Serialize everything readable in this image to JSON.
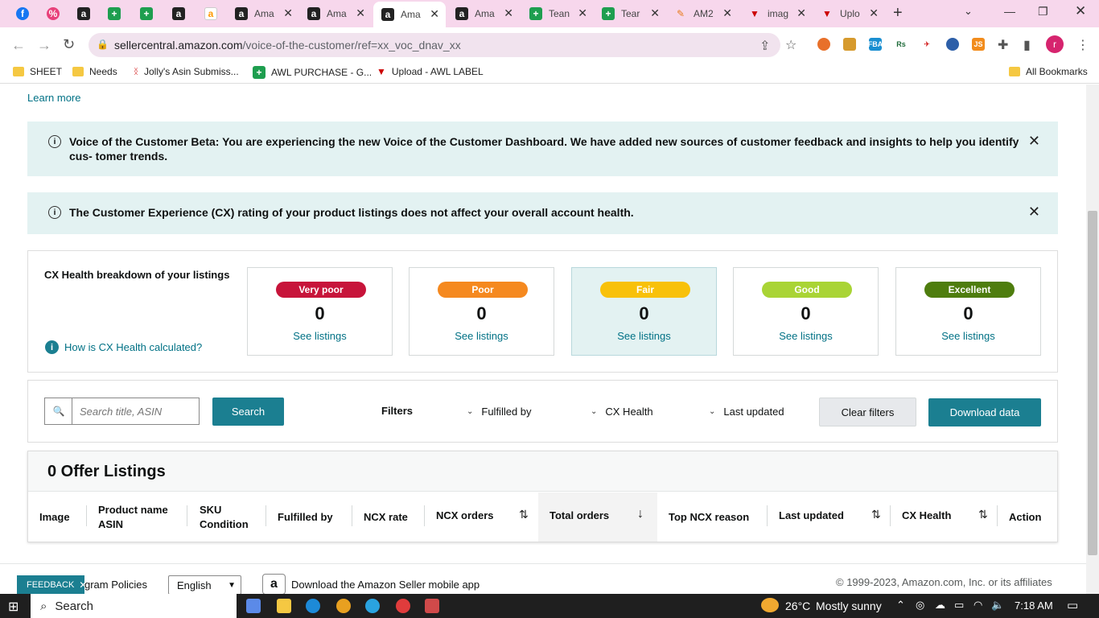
{
  "browser": {
    "tabs": [
      {
        "title": "",
        "icon": "facebook-icon"
      },
      {
        "title": "",
        "icon": "percent-icon"
      },
      {
        "title": "",
        "icon": "amazon-a-icon"
      },
      {
        "title": "",
        "icon": "sheets-icon"
      },
      {
        "title": "",
        "icon": "sheets-icon"
      },
      {
        "title": "",
        "icon": "amazon-a-icon"
      },
      {
        "title": "",
        "icon": "amazon-smile-icon"
      },
      {
        "title": "Ama",
        "icon": "amazon-a-icon"
      },
      {
        "title": "Ama",
        "icon": "amazon-a-icon"
      },
      {
        "title": "Ama",
        "icon": "amazon-a-icon",
        "active": true
      },
      {
        "title": "Ama",
        "icon": "amazon-a-icon"
      },
      {
        "title": "Tean",
        "icon": "sheets-icon"
      },
      {
        "title": "Tear",
        "icon": "sheets-icon"
      },
      {
        "title": "AM2",
        "icon": "pen-icon"
      },
      {
        "title": "imag",
        "icon": "v-logo-icon"
      },
      {
        "title": "Uplo",
        "icon": "v-logo-icon"
      }
    ],
    "new_tab": "+",
    "url_domain": "sellercentral.amazon.com",
    "url_path": "/voice-of-the-customer/ref=xx_voc_dnav_xx",
    "profile_initial": "r",
    "bookmarks": [
      {
        "label": "SHEET",
        "icon": "folder-icon"
      },
      {
        "label": "Needs",
        "icon": "folder-icon"
      },
      {
        "label": "Jolly's Asin Submiss...",
        "icon": "bookmark-icon"
      },
      {
        "label": "AWL PURCHASE - G...",
        "icon": "sheets-icon"
      },
      {
        "label": "Upload - AWL LABEL",
        "icon": "v-logo-icon"
      }
    ],
    "all_bookmarks": "All Bookmarks"
  },
  "page": {
    "learn_more": "Learn more",
    "alert1": "Voice of the Customer Beta: You are experiencing the new Voice of the Customer Dashboard. We have added new sources of customer feedback and insights to help you identify cus- tomer trends.",
    "alert2": "The Customer Experience (CX) rating of your product listings does not affect your overall account health.",
    "breakdown_title": "CX Health breakdown of your listings",
    "how_calculated": "How is CX Health calculated?",
    "cards": [
      {
        "label": "Very poor",
        "count": "0",
        "link": "See listings",
        "color": "#c7143a"
      },
      {
        "label": "Poor",
        "count": "0",
        "link": "See listings",
        "color": "#f5891f"
      },
      {
        "label": "Fair",
        "count": "0",
        "link": "See listings",
        "color": "#f8c10a"
      },
      {
        "label": "Good",
        "count": "0",
        "link": "See listings",
        "color": "#a9d435"
      },
      {
        "label": "Excellent",
        "count": "0",
        "link": "See listings",
        "color": "#4e7d0e"
      }
    ],
    "search_placeholder": "Search title, ASIN",
    "search_button": "Search",
    "filters_label": "Filters",
    "filter_fulfilled": "Fulfilled by",
    "filter_cx": "CX Health",
    "filter_updated": "Last updated",
    "clear_filters": "Clear filters",
    "download_data": "Download data",
    "offer_listings": "0 Offer Listings",
    "columns": {
      "image": "Image",
      "product_name": "Product name",
      "asin": "ASIN",
      "sku": "SKU",
      "condition": "Condition",
      "fulfilled_by": "Fulfilled by",
      "ncx_rate": "NCX rate",
      "ncx_orders": "NCX orders",
      "total_orders": "Total orders",
      "top_ncx_reason": "Top NCX reason",
      "last_updated": "Last updated",
      "cx_health": "CX Health",
      "action": "Action"
    },
    "footer": {
      "feedback": "FEEDBACK",
      "program_policies": "gram Policies",
      "language": "English",
      "mobile_app": "Download the Amazon Seller mobile app",
      "copyright": "© 1999-2023, Amazon.com, Inc. or its affiliates"
    }
  },
  "taskbar": {
    "search": "Search",
    "weather_temp": "26°C",
    "weather_desc": "Mostly sunny",
    "time": "7:18 AM"
  }
}
